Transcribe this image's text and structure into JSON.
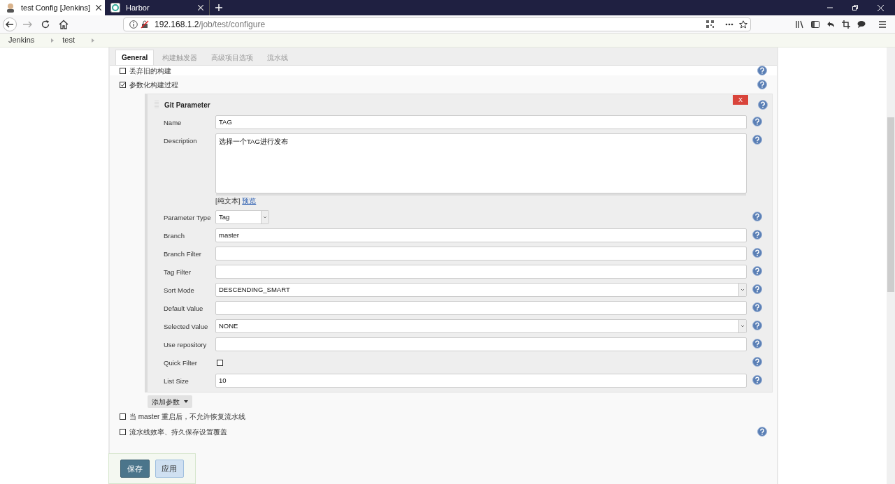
{
  "browser": {
    "tabs": [
      {
        "title": "test Config [Jenkins]",
        "selected": true
      },
      {
        "title": "Harbor",
        "selected": false
      }
    ],
    "address": {
      "host": "192.168.1.2",
      "path": "/job/test/configure"
    }
  },
  "breadcrumb": [
    "Jenkins",
    "test"
  ],
  "config_tabs": [
    {
      "label": "General",
      "selected": true
    },
    {
      "label": "构建触发器",
      "selected": false
    },
    {
      "label": "高级项目选项",
      "selected": false
    },
    {
      "label": "流水线",
      "selected": false
    }
  ],
  "options_top": [
    {
      "label": "丢弃旧的构建",
      "checked": false,
      "help": true
    },
    {
      "label": "参数化构建过程",
      "checked": true,
      "help": true
    }
  ],
  "parameter": {
    "title": "Git Parameter",
    "delete": "X",
    "fields": [
      {
        "label": "Name",
        "kind": "text",
        "value": "TAG"
      },
      {
        "label": "Description",
        "kind": "textarea",
        "value": "选择一个TAG进行发布",
        "format": "[纯文本]",
        "preview": "预览"
      },
      {
        "label": "Parameter Type",
        "kind": "select",
        "value": "Tag"
      },
      {
        "label": "Branch",
        "kind": "text",
        "value": "master"
      },
      {
        "label": "Branch Filter",
        "kind": "text"
      },
      {
        "label": "Tag Filter",
        "kind": "text"
      },
      {
        "label": "Sort Mode",
        "kind": "select-wide",
        "value": "DESCENDING_SMART"
      },
      {
        "label": "Default Value",
        "kind": "text"
      },
      {
        "label": "Selected Value",
        "kind": "select-wide",
        "value": "NONE"
      },
      {
        "label": "Use repository",
        "kind": "text"
      },
      {
        "label": "Quick Filter",
        "kind": "checkbox",
        "checked": false
      },
      {
        "label": "List Size",
        "kind": "text",
        "value": "10"
      }
    ]
  },
  "add_parameter": "添加参数",
  "options_bottom": [
    {
      "label": "当 master 重启后，不允许恢复流水线",
      "checked": false,
      "help": false
    },
    {
      "label": "流水线效率、持久保存设置覆盖",
      "checked": false,
      "help": true
    }
  ],
  "buttons": [
    {
      "label": "保存",
      "kind": "primary"
    },
    {
      "label": "应用",
      "kind": "secondary"
    }
  ]
}
